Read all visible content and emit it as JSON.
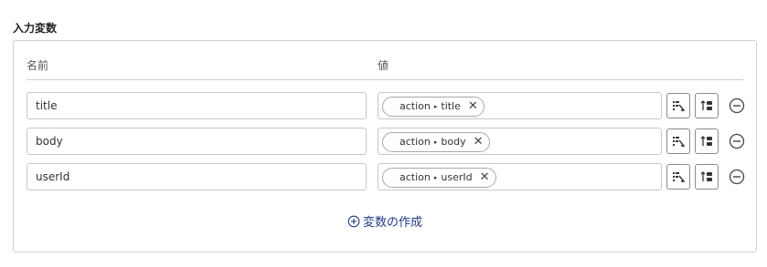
{
  "section_title": "入力変数",
  "columns": {
    "name": "名前",
    "value": "値"
  },
  "rows": [
    {
      "name": "title",
      "chip": {
        "source": "action",
        "field": "title"
      }
    },
    {
      "name": "body",
      "chip": {
        "source": "action",
        "field": "body"
      }
    },
    {
      "name": "userId",
      "chip": {
        "source": "action",
        "field": "userId"
      }
    }
  ],
  "chip_caret": "▸",
  "chip_remove_glyph": "✕",
  "create_variable_label": "変数の作成",
  "icons": {
    "select": "select-variable-icon",
    "sort": "sort-icon",
    "remove_row": "minus-circle-icon",
    "create": "plus-circle-icon"
  },
  "colors": {
    "accent": "#1f3a8a",
    "border": "#c8c8c8"
  }
}
